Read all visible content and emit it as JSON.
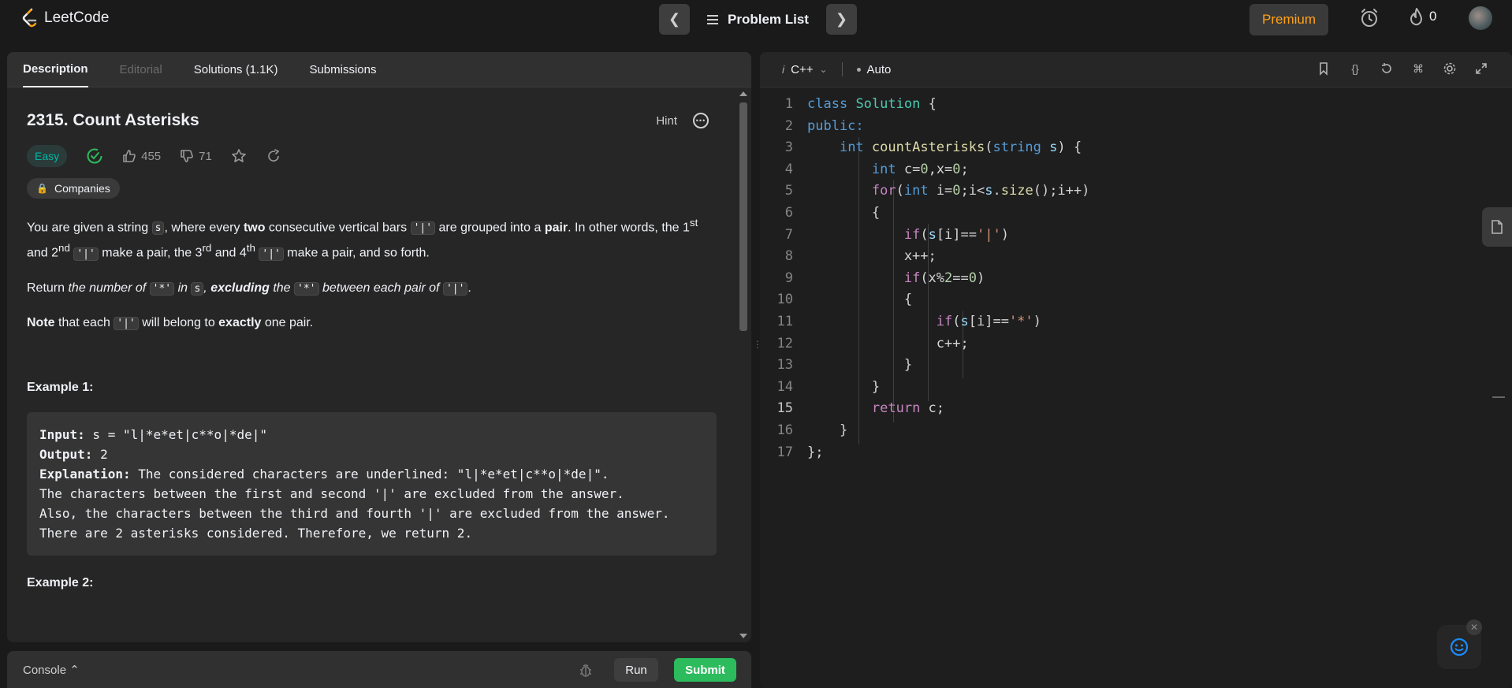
{
  "topbar": {
    "logo_text": "LeetCode",
    "problem_list": "Problem List",
    "premium": "Premium",
    "streak": "0"
  },
  "tabs": [
    {
      "label": "Description",
      "state": "active"
    },
    {
      "label": "Editorial",
      "state": "disabled"
    },
    {
      "label": "Solutions (1.1K)",
      "state": "normal"
    },
    {
      "label": "Submissions",
      "state": "normal"
    }
  ],
  "problem": {
    "title": "2315. Count Asterisks",
    "hint": "Hint",
    "difficulty": "Easy",
    "likes": "455",
    "dislikes": "71",
    "companies": "Companies"
  },
  "description": {
    "p1_a": "You are given a string ",
    "p1_s": "s",
    "p1_b": ", where every ",
    "p1_two": "two",
    "p1_c": " consecutive vertical bars ",
    "bar": "'|'",
    "p1_d": " are grouped into a ",
    "p1_pair": "pair",
    "p1_e": ". In other words, the 1",
    "st": "st",
    "and": " and 2",
    "nd": "nd",
    "p1_f": " make a pair, the 3",
    "rd": "rd",
    "p1_g": " and 4",
    "th": "th",
    "p1_h": " make a pair, and so forth.",
    "p2_a": "Return ",
    "p2_b": "the number of ",
    "star": "'*'",
    "p2_c": " in ",
    "p2_d": ", ",
    "p2_excluding": "excluding",
    "p2_e": " the ",
    "p2_f": " between each pair of ",
    "p2_g": ".",
    "p3_note": "Note",
    "p3_a": " that each ",
    "p3_b": " will belong to ",
    "p3_exactly": "exactly",
    "p3_c": " one pair."
  },
  "example1": {
    "title": "Example 1:",
    "input_label": "Input:",
    "input_value": " s = \"l|*e*et|c**o|*de|\"",
    "output_label": "Output:",
    "output_value": " 2",
    "explanation_label": "Explanation:",
    "explanation_value": " The considered characters are underlined: \"l|*e*et|c**o|*de|\".\nThe characters between the first and second '|' are excluded from the answer.\nAlso, the characters between the third and fourth '|' are excluded from the answer.\nThere are 2 asterisks considered. Therefore, we return 2."
  },
  "example2": {
    "title": "Example 2:"
  },
  "console": {
    "label": "Console",
    "run": "Run",
    "submit": "Submit"
  },
  "editor": {
    "language": "C++",
    "mode": "Auto",
    "current_line": 15
  },
  "code_lines": [
    "class Solution {",
    "public:",
    "    int countAsterisks(string s) {",
    "        int c=0,x=0;",
    "        for(int i=0;i<s.size();i++)",
    "        {",
    "            if(s[i]=='|')",
    "            x++;",
    "            if(x%2==0)",
    "            {",
    "                if(s[i]=='*')",
    "                c++;",
    "            }",
    "        }",
    "        return c;",
    "    }",
    "};"
  ],
  "colors": {
    "accent": "#ffa116",
    "easy": "#00b8a3",
    "submit": "#2cbb5d"
  }
}
